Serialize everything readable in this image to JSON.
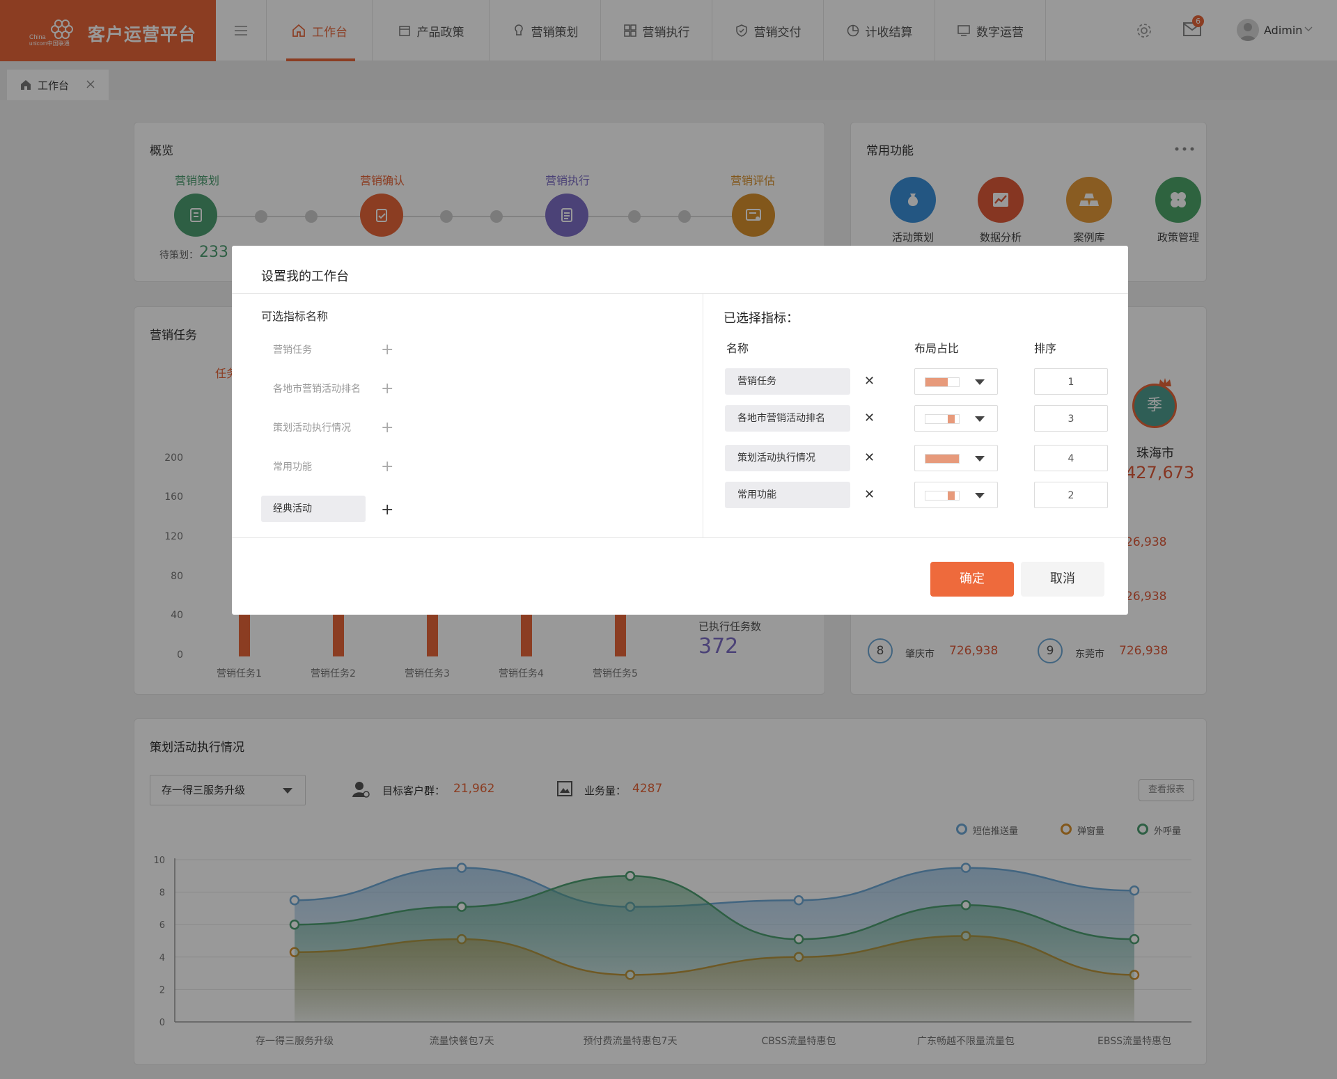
{
  "app": {
    "title": "客户运营平台"
  },
  "nav": {
    "items": [
      {
        "label": "工作台",
        "icon": "home-icon"
      },
      {
        "label": "产品政策",
        "icon": "policy-icon"
      },
      {
        "label": "营销策划",
        "icon": "bulb-icon"
      },
      {
        "label": "营销执行",
        "icon": "grid-icon"
      },
      {
        "label": "营销交付",
        "icon": "shield-icon"
      },
      {
        "label": "计收结算",
        "icon": "pie-icon"
      },
      {
        "label": "数字运营",
        "icon": "monitor-icon"
      }
    ]
  },
  "header": {
    "mail_badge": "6",
    "username": "Adimin"
  },
  "tabs": [
    {
      "label": "工作台"
    }
  ],
  "overview": {
    "title": "概览",
    "stages": [
      "营销策划",
      "营销确认",
      "营销执行",
      "营销评估"
    ],
    "pending_label": "待策划：",
    "pending_value": "233"
  },
  "common": {
    "title": "常用功能",
    "items": [
      "活动策划",
      "数据分析",
      "案例库",
      "政策管理"
    ]
  },
  "tasks": {
    "title": "营销任务",
    "tab_fragment": "任务",
    "yticks": [
      "200",
      "160",
      "120",
      "80",
      "40",
      "0"
    ],
    "categories": [
      "营销任务1",
      "营销任务2",
      "营销任务3",
      "营销任务4",
      "营销任务5"
    ],
    "executed_label": "已执行任务数",
    "executed_value": "372"
  },
  "ranking": {
    "season_badge": "季",
    "city": "珠海市",
    "value": "427,673",
    "partial_values": [
      "26,938",
      "26,938"
    ],
    "rows": [
      {
        "rank": "8",
        "city": "肇庆市",
        "value": "726,938"
      },
      {
        "rank": "9",
        "city": "东莞市",
        "value": "726,938"
      }
    ]
  },
  "exec": {
    "title": "策划活动执行情况",
    "select_value": "存一得三服务升级",
    "target_label": "目标客户群：",
    "target_value": "21,962",
    "biz_label": "业务量：",
    "biz_value": "4287",
    "report_button": "查看报表",
    "legend": [
      {
        "name": "短信推送量",
        "color": "#6fa8d6"
      },
      {
        "name": "弹窗量",
        "color": "#d9922e"
      },
      {
        "name": "外呼量",
        "color": "#4e9e72"
      }
    ],
    "yticks": [
      "10",
      "8",
      "6",
      "4",
      "2",
      "0"
    ]
  },
  "chart_data": {
    "type": "area",
    "x": [
      "存一得三服务升级",
      "流量快餐包7天",
      "预付费流量特惠包7天",
      "CBSS流量特惠包",
      "广东畅越不限量流量包",
      "EBSS流量特惠包"
    ],
    "ylim": [
      0,
      10
    ],
    "series": [
      {
        "name": "短信推送量",
        "values": [
          7.5,
          9.5,
          7.1,
          7.5,
          9.5,
          8.1
        ]
      },
      {
        "name": "弹窗量",
        "values": [
          4.3,
          5.1,
          2.9,
          4.0,
          5.3,
          2.9
        ]
      },
      {
        "name": "外呼量",
        "values": [
          6.0,
          7.1,
          9.0,
          5.1,
          7.2,
          5.1
        ]
      }
    ]
  },
  "modal": {
    "title": "设置我的工作台",
    "available_title": "可选指标名称",
    "available": [
      {
        "label": "营销任务",
        "enabled": false
      },
      {
        "label": "各地市营销活动排名",
        "enabled": false
      },
      {
        "label": "策划活动执行情况",
        "enabled": false
      },
      {
        "label": "常用功能",
        "enabled": false
      },
      {
        "label": "经典活动",
        "enabled": true
      }
    ],
    "selected_title": "已选择指标：",
    "col_name": "名称",
    "col_ratio": "布局占比",
    "col_order": "排序",
    "selected": [
      {
        "label": "营销任务",
        "ratio": 0.67,
        "order": "1"
      },
      {
        "label": "各地市营销活动排名",
        "ratio": 0.33,
        "order": "3"
      },
      {
        "label": "策划活动执行情况",
        "ratio": 1.0,
        "order": "4"
      },
      {
        "label": "常用功能",
        "ratio": 0.33,
        "order": "2"
      }
    ],
    "ok_label": "确定",
    "cancel_label": "取消"
  },
  "colors": {
    "brand": "#e8663a",
    "accent_blue": "#6fa8d6",
    "accent_green": "#4e9e72",
    "accent_orange": "#d9922e",
    "purple": "#7e6fc6"
  }
}
